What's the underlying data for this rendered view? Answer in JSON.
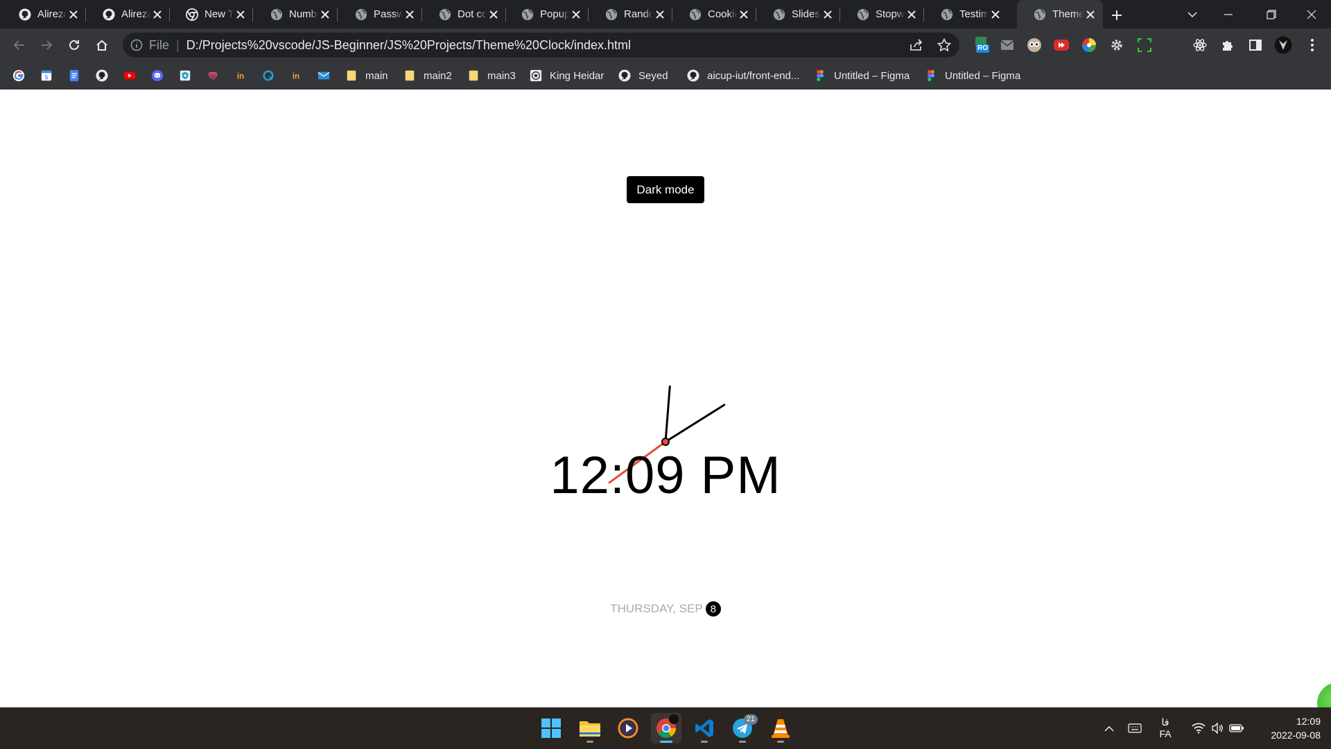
{
  "browser": {
    "tabs": [
      {
        "title": "Alireza",
        "icon": "github-icon"
      },
      {
        "title": "Alireza",
        "icon": "github-icon"
      },
      {
        "title": "New Tab",
        "icon": "chrome-icon"
      },
      {
        "title": "Number",
        "icon": "globe-icon"
      },
      {
        "title": "Password",
        "icon": "globe-icon"
      },
      {
        "title": "Dot com",
        "icon": "globe-icon"
      },
      {
        "title": "Popup",
        "icon": "globe-icon"
      },
      {
        "title": "Random",
        "icon": "globe-icon"
      },
      {
        "title": "Cookie",
        "icon": "globe-icon"
      },
      {
        "title": "Slideshow",
        "icon": "globe-icon"
      },
      {
        "title": "Stopwatch",
        "icon": "globe-icon"
      },
      {
        "title": "Testimonial",
        "icon": "globe-icon"
      },
      {
        "title": "Theme Clock",
        "icon": "globe-icon",
        "active": true
      }
    ],
    "address": {
      "scheme_label": "File",
      "url": "D:/Projects%20vscode/JS-Beginner/JS%20Projects/Theme%20Clock/index.html"
    },
    "extension_badge": "RO",
    "bookmarks": [
      {
        "label": "",
        "icon": "google-icon"
      },
      {
        "label": "",
        "icon": "calendar-icon"
      },
      {
        "label": "",
        "icon": "docs-icon"
      },
      {
        "label": "",
        "icon": "github-icon"
      },
      {
        "label": "",
        "icon": "youtube-icon"
      },
      {
        "label": "",
        "icon": "discord-icon"
      },
      {
        "label": "",
        "icon": "shield-icon"
      },
      {
        "label": "",
        "icon": "fingerprint-icon"
      },
      {
        "label": "",
        "icon": "invision-icon"
      },
      {
        "label": "",
        "icon": "q-icon"
      },
      {
        "label": "",
        "icon": "invision-icon"
      },
      {
        "label": "",
        "icon": "mail-icon"
      },
      {
        "label": "main",
        "icon": "folder-icon"
      },
      {
        "label": "main2",
        "icon": "folder-icon"
      },
      {
        "label": "main3",
        "icon": "folder-icon"
      },
      {
        "label": "King Heidar",
        "icon": "site-icon"
      },
      {
        "label": "Seyed",
        "icon": "github-icon"
      },
      {
        "label": "aicup-iut/front-end...",
        "icon": "github-icon"
      },
      {
        "label": "Untitled – Figma",
        "icon": "figma-icon"
      },
      {
        "label": "Untitled – Figma",
        "icon": "figma-icon"
      }
    ]
  },
  "page": {
    "toggle_label": "Dark mode",
    "time": "12:09 PM",
    "date_text": "THURSDAY, SEP",
    "date_day": "8",
    "clock": {
      "hour": 12,
      "minute": 9,
      "second": 39
    }
  },
  "taskbar": {
    "apps": [
      "start-icon",
      "file-explorer-icon",
      "media-player-icon",
      "chrome-icon",
      "vscode-icon",
      "telegram-icon",
      "vlc-icon"
    ],
    "telegram_badge": "21",
    "language": "FA",
    "language_script": "فا",
    "clock_time": "12:09",
    "clock_date": "2022-09-08"
  },
  "colors": {
    "tabstrip": "#202124",
    "toolbar": "#35363a",
    "second_hand": "#e74c3c",
    "taskbar": "#2b2522",
    "accent": "#4cc2ff"
  }
}
